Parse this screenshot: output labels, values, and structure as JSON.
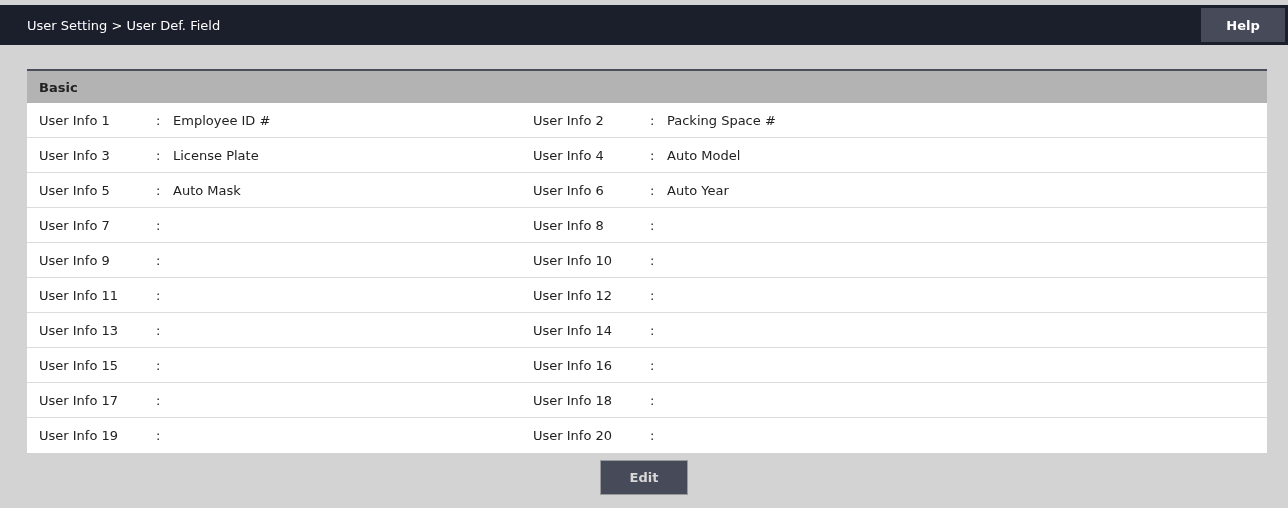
{
  "header": {
    "breadcrumb": "User Setting > User Def. Field",
    "help_button": "Help"
  },
  "section": {
    "title": "Basic",
    "rows": [
      [
        {
          "label": "User Info 1",
          "separator": ":",
          "value": "Employee ID #"
        },
        {
          "label": "User Info 2",
          "separator": ":",
          "value": "Packing Space #"
        }
      ],
      [
        {
          "label": "User Info 3",
          "separator": ":",
          "value": "License Plate"
        },
        {
          "label": "User Info 4",
          "separator": ":",
          "value": "Auto Model"
        }
      ],
      [
        {
          "label": "User Info 5",
          "separator": ":",
          "value": "Auto Mask"
        },
        {
          "label": "User Info 6",
          "separator": ":",
          "value": "Auto Year"
        }
      ],
      [
        {
          "label": "User Info 7",
          "separator": ":"
        },
        {
          "label": "User Info 8",
          "separator": ":"
        }
      ],
      [
        {
          "label": "User Info 9",
          "separator": ":"
        },
        {
          "label": "User Info 10",
          "separator": ":"
        }
      ],
      [
        {
          "label": "User Info 11",
          "separator": ":"
        },
        {
          "label": "User Info 12",
          "separator": ":"
        }
      ],
      [
        {
          "label": "User Info 13",
          "separator": ":"
        },
        {
          "label": "User Info 14",
          "separator": ":"
        }
      ],
      [
        {
          "label": "User Info 15",
          "separator": ":"
        },
        {
          "label": "User Info 16",
          "separator": ":"
        }
      ],
      [
        {
          "label": "User Info 17",
          "separator": ":"
        },
        {
          "label": "User Info 18",
          "separator": ":"
        }
      ],
      [
        {
          "label": "User Info 19",
          "separator": ":"
        },
        {
          "label": "User Info 20",
          "separator": ":"
        }
      ]
    ]
  },
  "edit_button": "Edit"
}
